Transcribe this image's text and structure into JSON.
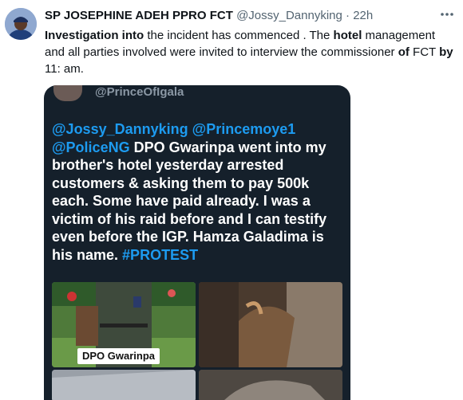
{
  "tweet": {
    "author_name": "SP JOSEPHINE ADEH PPRO FCT",
    "handle": "@Jossy_Dannyking",
    "separator": "·",
    "time": "22h",
    "more_icon": "more-horizontal-icon",
    "text_parts": {
      "p1_bold": "Investigation into",
      "p2": " the incident has commenced . The ",
      "p3_bold": "hotel",
      "p4": " management and all parties involved were  invited to interview the commissioner ",
      "p5_bold": "of",
      "p6": " FCT ",
      "p7_bold": "by",
      "p8": " 11: am."
    }
  },
  "quoted": {
    "handle": "@PrinceOfIgala",
    "mention1": "@Jossy_Dannyking",
    "mention2": "@Princemoye1",
    "mention3": "@PoliceNG",
    "body": " DPO Gwarinpa went into my brother's hotel yesterday arrested customers & asking them to pay 500k each. Some have paid already. I was a victim of his raid before and I can testify even before the IGP. Hamza Galadima is his name.",
    "hashtag": "#PROTEST",
    "image_caption": "DPO Gwarinpa"
  },
  "colors": {
    "link_blue": "#1d9bf0",
    "media_bg": "#15202b",
    "muted": "#536471"
  }
}
